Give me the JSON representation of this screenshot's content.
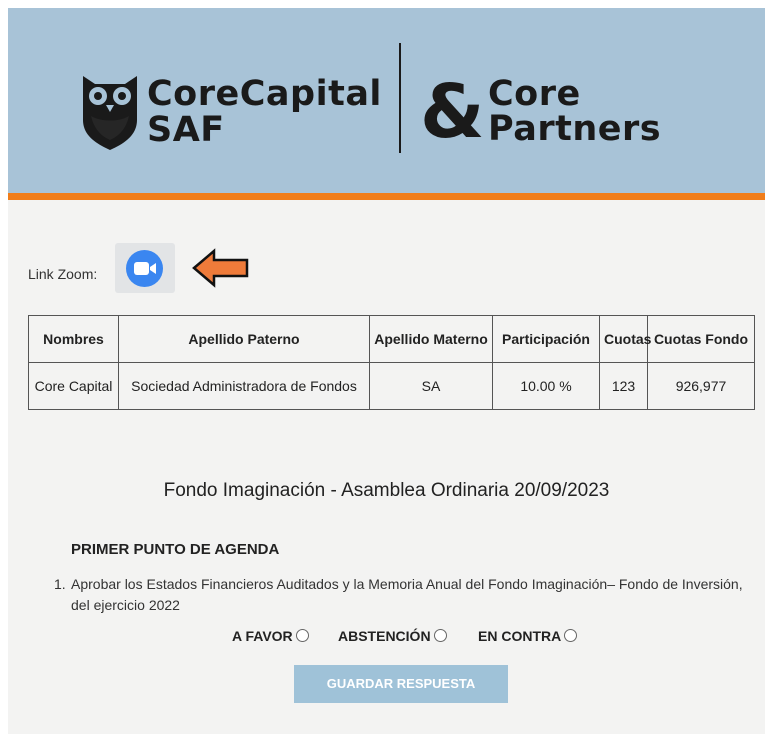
{
  "header": {
    "brand_primary_name": "CoreCapital",
    "brand_primary_sub": "SAF",
    "brand_secondary_symbol": "&",
    "brand_secondary_name": "Core",
    "brand_secondary_sub": "Partners",
    "background_color": "#a8c3d7",
    "accent_color": "#f07d1a"
  },
  "zoom": {
    "label": "Link Zoom:",
    "icon": "zoom-video-icon",
    "pointer_icon": "arrow-left-icon"
  },
  "table": {
    "headers": [
      "Nombres",
      "Apellido Paterno",
      "Apellido Materno",
      "Participación",
      "Cuotas",
      "Cuotas Fondo"
    ],
    "rows": [
      [
        "Core Capital",
        "Sociedad Administradora de Fondos",
        "SA",
        "10.00 %",
        "123",
        "926,977"
      ]
    ]
  },
  "fund_title": "Fondo Imaginación - Asamblea Ordinaria 20/09/2023",
  "agenda": {
    "title": "PRIMER PUNTO DE AGENDA",
    "item_number": "1.",
    "item_text": "Aprobar los Estados Financieros Auditados y la Memoria Anual del Fondo Imaginación– Fondo de Inversión, del ejercicio 2022",
    "options": {
      "favor": "A FAVOR",
      "abstencion": "ABSTENCIÓN",
      "contra": "EN CONTRA"
    }
  },
  "save_button": "GUARDAR RESPUESTA"
}
